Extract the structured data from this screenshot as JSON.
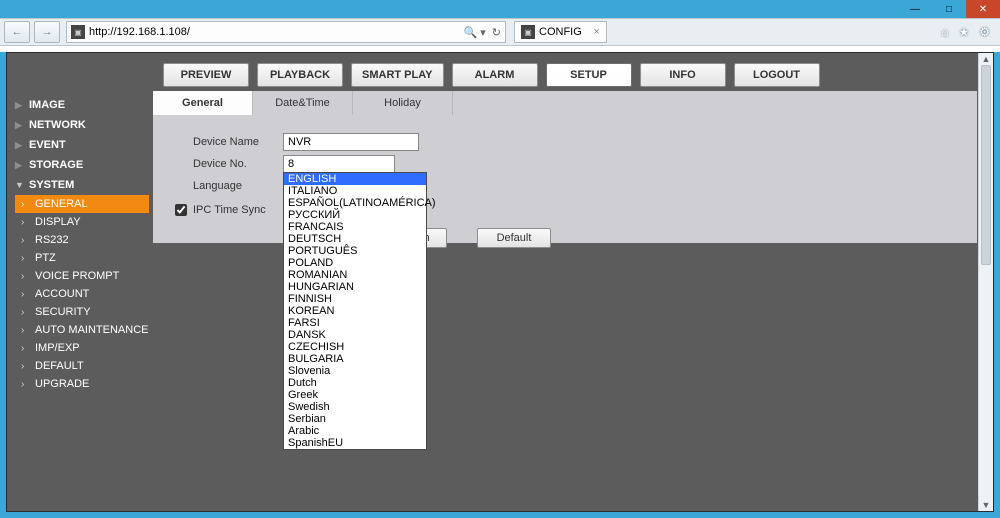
{
  "window": {
    "minimize": "—",
    "maximize": "□",
    "close": "✕"
  },
  "browser": {
    "url_prefix": "http://",
    "url_host": "192.168.1.108/",
    "search_hint": "🔍 ▾",
    "refresh": "↻",
    "tab_title": "CONFIG",
    "tab_close": "×",
    "icons": {
      "home": "⌂",
      "star": "★",
      "gear": "⚙"
    }
  },
  "topnav": {
    "preview": "PREVIEW",
    "playback": "PLAYBACK",
    "smartplay": "SMART PLAY",
    "alarm": "ALARM",
    "setup": "SETUP",
    "info": "INFO",
    "logout": "LOGOUT"
  },
  "sidebar": {
    "sections": {
      "image": "IMAGE",
      "network": "NETWORK",
      "event": "EVENT",
      "storage": "STORAGE",
      "system": "SYSTEM"
    },
    "system_items": {
      "general": "GENERAL",
      "display": "DISPLAY",
      "rs232": "RS232",
      "ptz": "PTZ",
      "voice": "VOICE PROMPT",
      "account": "ACCOUNT",
      "security": "SECURITY",
      "automaint": "AUTO MAINTENANCE",
      "impexp": "IMP/EXP",
      "default": "DEFAULT",
      "upgrade": "UPGRADE"
    }
  },
  "subtabs": {
    "general": "General",
    "datetime": "Date&Time",
    "holiday": "Holiday"
  },
  "form": {
    "device_name_label": "Device Name",
    "device_name_value": "NVR",
    "device_no_label": "Device No.",
    "device_no_value": "8",
    "language_label": "Language",
    "language_value": "ENGLISH",
    "ipc_sync_label": "IPC Time Sync",
    "ipc_sync_checked": true,
    "button_partial": "h",
    "button_default": "Default"
  },
  "language_options": [
    "ENGLISH",
    "ITALIANO",
    "ESPAÑOL(LATINOAMÉRICA)",
    "РУССКИЙ",
    "FRANCAIS",
    "DEUTSCH",
    "PORTUGUÊS",
    "POLAND",
    "ROMANIAN",
    "HUNGARIAN",
    "FINNISH",
    "KOREAN",
    "FARSI",
    "DANSK",
    "CZECHISH",
    "BULGARIA",
    "Slovenia",
    "Dutch",
    "Greek",
    "Swedish",
    "Serbian",
    "Arabic",
    "SpanishEU"
  ]
}
